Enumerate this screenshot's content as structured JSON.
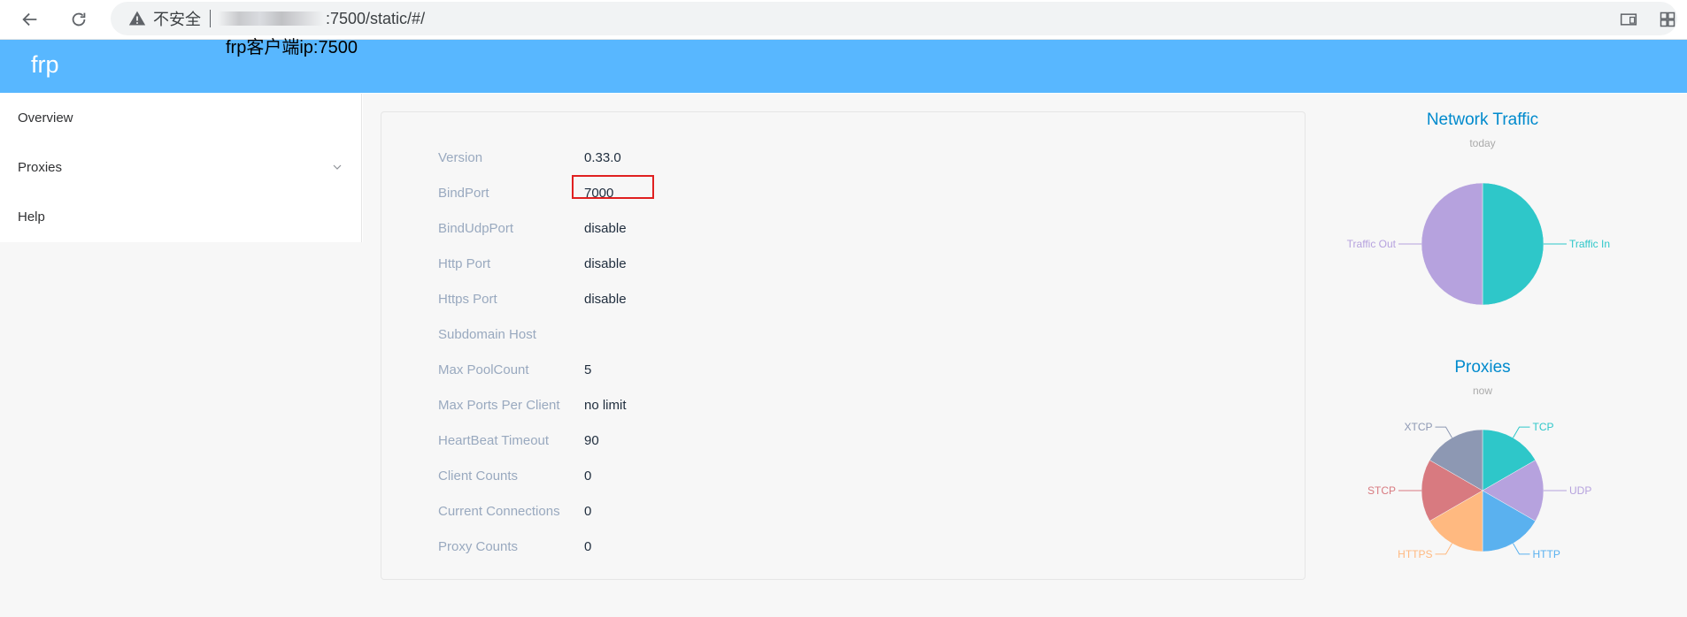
{
  "browser": {
    "security_label": "不安全",
    "url_visible": ":7500/static/#/"
  },
  "annotation": {
    "caption": "frp客户端ip:7500"
  },
  "app": {
    "title": "frp"
  },
  "sidebar": {
    "items": [
      {
        "label": "Overview"
      },
      {
        "label": "Proxies"
      },
      {
        "label": "Help"
      }
    ]
  },
  "server_info": {
    "rows": [
      {
        "label": "Version",
        "value": "0.33.0"
      },
      {
        "label": "BindPort",
        "value": "7000"
      },
      {
        "label": "BindUdpPort",
        "value": "disable"
      },
      {
        "label": "Http Port",
        "value": "disable"
      },
      {
        "label": "Https Port",
        "value": "disable"
      },
      {
        "label": "Subdomain Host",
        "value": ""
      },
      {
        "label": "Max PoolCount",
        "value": "5"
      },
      {
        "label": "Max Ports Per Client",
        "value": "no limit"
      },
      {
        "label": "HeartBeat Timeout",
        "value": "90"
      },
      {
        "label": "Client Counts",
        "value": "0"
      },
      {
        "label": "Current Connections",
        "value": "0"
      },
      {
        "label": "Proxy Counts",
        "value": "0"
      }
    ]
  },
  "chart_data": [
    {
      "type": "pie",
      "title": "Network Traffic",
      "subtitle": "today",
      "slices": [
        {
          "label": "Traffic In",
          "value": 50,
          "color": "#2ec7c9"
        },
        {
          "label": "Traffic Out",
          "value": 50,
          "color": "#b6a2de"
        }
      ]
    },
    {
      "type": "pie",
      "title": "Proxies",
      "subtitle": "now",
      "slices": [
        {
          "label": "TCP",
          "value": 1,
          "color": "#2ec7c9"
        },
        {
          "label": "UDP",
          "value": 1,
          "color": "#b6a2de"
        },
        {
          "label": "HTTP",
          "value": 1,
          "color": "#5ab1ef"
        },
        {
          "label": "HTTPS",
          "value": 1,
          "color": "#ffb980"
        },
        {
          "label": "STCP",
          "value": 1,
          "color": "#d87a80"
        },
        {
          "label": "XTCP",
          "value": 1,
          "color": "#8d98b3"
        }
      ]
    }
  ]
}
